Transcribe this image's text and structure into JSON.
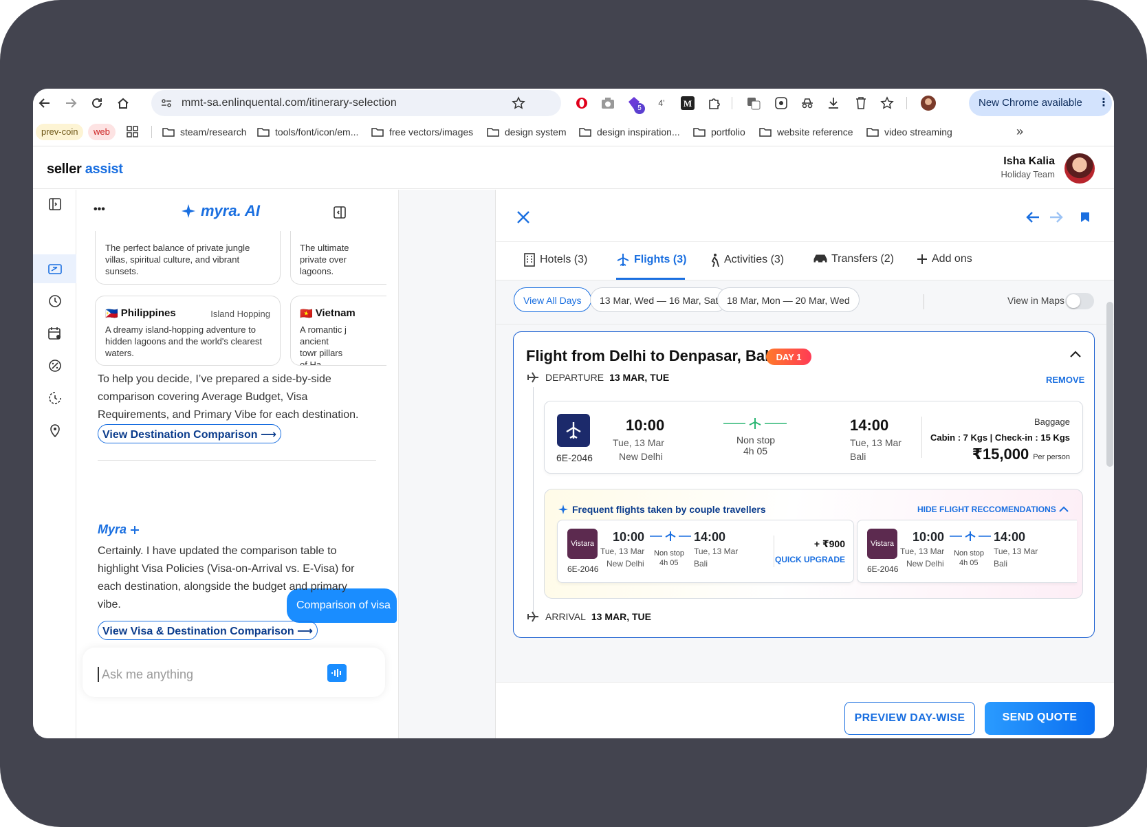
{
  "browser": {
    "url": "mmt-sa.enlinquental.com/itinerary-selection",
    "ext_badge": "5",
    "ext_text": "4’",
    "new_chrome": "New Chrome available"
  },
  "bookmarks": {
    "tags": [
      "prev-coin",
      "web"
    ],
    "items": [
      "steam/research",
      "tools/font/icon/em...",
      "free vectors/images",
      "design system",
      "design inspiration...",
      "portfolio",
      "website reference",
      "video streaming"
    ],
    "more": "»"
  },
  "app": {
    "logo_a": "seller",
    "logo_b": "assist",
    "user_name": "Isha Kalia",
    "user_team": "Holiday Team"
  },
  "chat": {
    "menu": "•••",
    "brand": "myra. AI",
    "card1_desc": "The perfect balance of private jungle villas, spiritual culture, and vibrant sunsets.",
    "card2_desc": "The ultimate private over lagoons.",
    "card3_flag": "🇵🇭",
    "card3_title": "Philippines",
    "card3_tag": "Island Hopping",
    "card3_desc": "A dreamy island-hopping adventure to hidden lagoons and the world's clearest waters.",
    "card4_flag": "🇻🇳",
    "card4_title": "Vietnam",
    "card4_desc": "A romantic j ancient towr pillars of Ha",
    "para1": "To help you decide, I’ve prepared a side-by-side comparison covering Average Budget, Visa Requirements, and Primary Vibe for each destination.",
    "link1": "View Destination Comparison ⟶",
    "user_msg": "Comparison of visa",
    "bot_name": "Myra",
    "para2": "Certainly. I have updated the comparison table to highlight Visa Policies (Visa-on-Arrival vs. E-Visa) for each destination, alongside the budget and primary vibe.",
    "link2": "View Visa & Destination Comparison ⟶",
    "input_placeholder": "Ask me anything"
  },
  "panel": {
    "tabs": [
      {
        "label": "Hotels (3)"
      },
      {
        "label": "Flights (3)"
      },
      {
        "label": "Activities (3)"
      },
      {
        "label": "Transfers (2)"
      },
      {
        "label": "Add ons"
      }
    ],
    "chips": [
      "View All Days",
      "13 Mar, Wed — 16 Mar, Sat",
      "18 Mar, Mon — 20 Mar, Wed"
    ],
    "view_maps": "View in Maps",
    "flight_title": "Flight from Delhi to Denpasar, Bali",
    "day_badge": "DAY 1",
    "departure_label": "DEPARTURE",
    "departure_date": "13 MAR, TUE",
    "remove": "REMOVE",
    "main": {
      "code": "6E-2046",
      "dep_time": "10:00",
      "dep_date": "Tue, 13 Mar",
      "dep_city": "New Delhi",
      "stops": "Non stop",
      "duration": "4h 05",
      "arr_time": "14:00",
      "arr_date": "Tue, 13 Mar",
      "arr_city": "Bali",
      "baggage_title": "Baggage",
      "baggage": "Cabin : 7 Kgs | Check-in : 15 Kgs",
      "price": "₹15,000",
      "per": "Per person"
    },
    "rec_title": "Frequent flights taken by couple travellers",
    "rec_hide": "HIDE FLIGHT RECCOMENDATIONS",
    "recs": [
      {
        "airline": "Vistara",
        "code": "6E-2046",
        "dep_time": "10:00",
        "dep_date": "Tue, 13 Mar",
        "dep_city": "New Delhi",
        "stops": "Non stop",
        "duration": "4h 05",
        "arr_time": "14:00",
        "arr_date": "Tue, 13 Mar",
        "arr_city": "Bali",
        "price_diff": "+ ₹900",
        "upgrade": "QUICK UPGRADE"
      },
      {
        "airline": "Vistara",
        "code": "6E-2046",
        "dep_time": "10:00",
        "dep_date": "Tue, 13 Mar",
        "dep_city": "New Delhi",
        "stops": "Non stop",
        "duration": "4h 05",
        "arr_time": "14:00",
        "arr_date": "Tue, 13 Mar",
        "arr_city": "Bali"
      }
    ],
    "arrival_label": "ARRIVAL",
    "arrival_date": "13 MAR, TUE",
    "btn_preview": "PREVIEW DAY-WISE",
    "btn_send": "SEND QUOTE"
  },
  "colors": {
    "accent": "#1a6fe0",
    "frame": "#43444f",
    "airline_indigo": "#1c2a6b",
    "vistara": "#5c2a4f",
    "badge": "#ff4b4b"
  }
}
